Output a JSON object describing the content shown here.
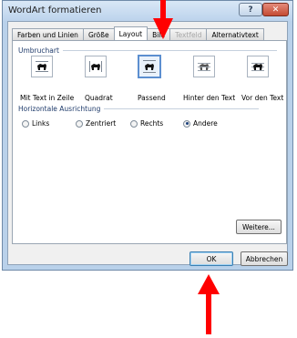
{
  "window": {
    "title": "WordArt formatieren",
    "help_symbol": "?",
    "close_symbol": "✕"
  },
  "tabs": [
    {
      "label": "Farben und Linien"
    },
    {
      "label": "Größe"
    },
    {
      "label": "Layout"
    },
    {
      "label": "Bild"
    },
    {
      "label": "Textfeld"
    },
    {
      "label": "Alternativtext"
    }
  ],
  "wrapping": {
    "heading": "Umbruchart",
    "options": [
      {
        "label": "Mit Text in Zeile",
        "selected": false
      },
      {
        "label": "Quadrat",
        "selected": false
      },
      {
        "label": "Passend",
        "selected": true
      },
      {
        "label": "Hinter den Text",
        "selected": false
      },
      {
        "label": "Vor den Text",
        "selected": false
      }
    ]
  },
  "alignment": {
    "heading": "Horizontale Ausrichtung",
    "options": [
      {
        "label": "Links",
        "checked": false
      },
      {
        "label": "Zentriert",
        "checked": false
      },
      {
        "label": "Rechts",
        "checked": false
      },
      {
        "label": "Andere",
        "checked": true
      }
    ]
  },
  "buttons": {
    "more": "Weitere...",
    "ok": "OK",
    "cancel": "Abbrechen"
  },
  "colors": {
    "arrow": "#ff0000",
    "selection": "#5c8fd0"
  }
}
